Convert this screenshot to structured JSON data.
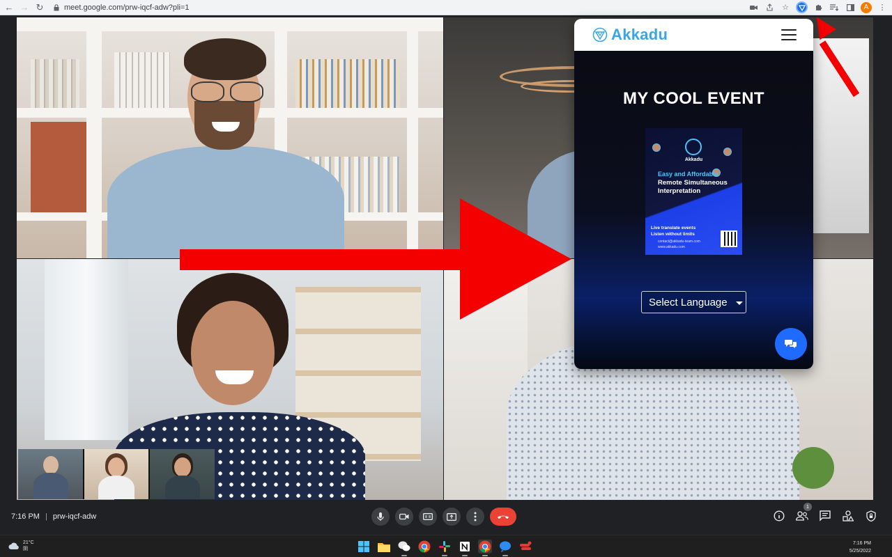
{
  "browser": {
    "url": "meet.google.com/prw-iqcf-adw?pli=1",
    "profile_initial": "A"
  },
  "akkadu": {
    "brand": "Akkadu",
    "event_title": "MY COOL EVENT",
    "poster": {
      "brand": "Akkadu",
      "tagline": "Easy and Affordable",
      "headline": "Remote Simultaneous Interpretation",
      "line1": "Live translate  events",
      "line2": "Listen without limits",
      "contact": "contact@akkadu-team.com",
      "website": "www.akkadu.com"
    },
    "language_select": "Select Language"
  },
  "meet": {
    "time": "7:16 PM",
    "separator": "|",
    "meeting_code": "prw-iqcf-adw",
    "participants_badge": "1"
  },
  "taskbar": {
    "weather_temp": "21°C",
    "weather_cond": "阴",
    "time": "7:16 PM",
    "date": "5/25/2022"
  },
  "colors": {
    "accent_blue": "#3aa5e6",
    "end_call_red": "#ea4335",
    "arrow_red": "#f40000",
    "fab_blue": "#1f6bff"
  }
}
